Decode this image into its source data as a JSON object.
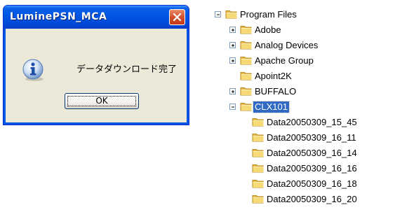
{
  "dialog": {
    "title": "LuminePSN_MCA",
    "message": "データダウンロード完了",
    "ok_label": "OK",
    "close_icon": "close-icon",
    "info_icon": "information-icon"
  },
  "tree": {
    "root": "Program Files",
    "items": [
      {
        "label": "Adobe",
        "expander": "plus"
      },
      {
        "label": "Analog Devices",
        "expander": "plus"
      },
      {
        "label": "Apache Group",
        "expander": "plus"
      },
      {
        "label": "Apoint2K",
        "expander": "none"
      },
      {
        "label": "BUFFALO",
        "expander": "plus"
      },
      {
        "label": "CLX101",
        "expander": "minus",
        "selected": true
      }
    ],
    "children": [
      "Data20050309_15_45",
      "Data20050309_16_11",
      "Data20050309_16_14",
      "Data20050309_16_16",
      "Data20050309_16_18",
      "Data20050309_16_20"
    ]
  },
  "colors": {
    "titlebar": "#0055e5",
    "selection": "#316ac5",
    "folder": "#f5d36b"
  }
}
